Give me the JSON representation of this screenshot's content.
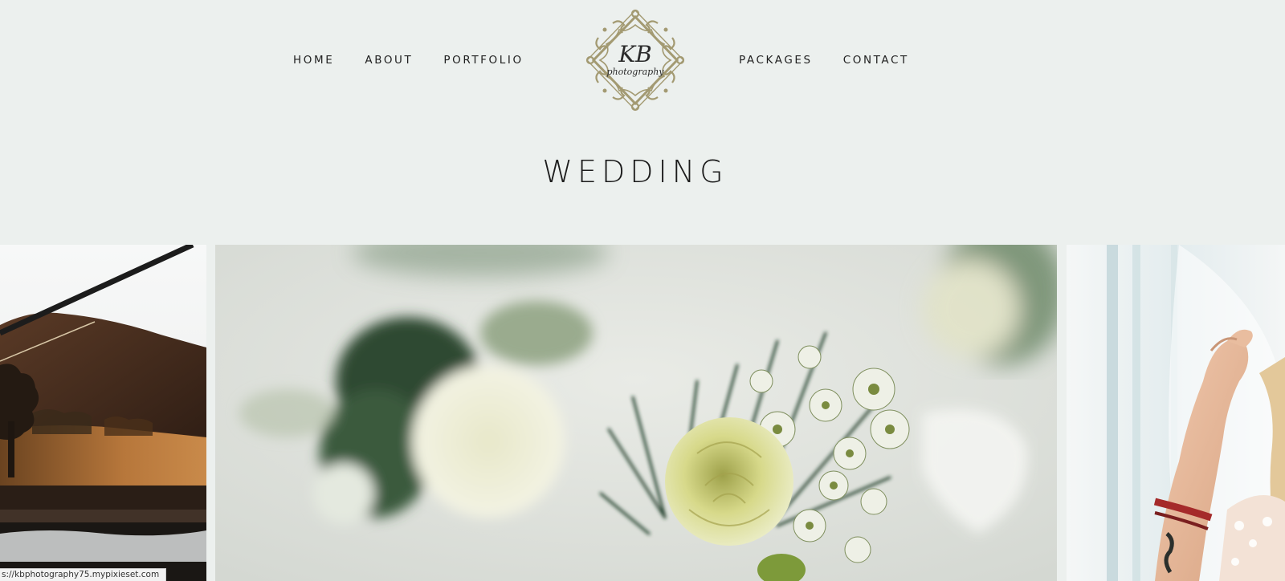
{
  "nav": {
    "left": [
      {
        "label": "HOME"
      },
      {
        "label": "ABOUT"
      },
      {
        "label": "PORTFOLIO"
      }
    ],
    "right": [
      {
        "label": "PACKAGES"
      },
      {
        "label": "CONTACT"
      }
    ]
  },
  "logo": {
    "initials": "KB",
    "subtitle": "photography",
    "color": "#a39a72"
  },
  "page": {
    "title": "WEDDING"
  },
  "gallery": {
    "photos": [
      {
        "subject": "landscape-sunset-hill"
      },
      {
        "subject": "rose-boutonnieres"
      },
      {
        "subject": "bride-veil"
      }
    ]
  },
  "status_bar": {
    "url": "s://kbphotography75.mypixieset.com"
  },
  "colors": {
    "background": "#ecf0ee",
    "text": "#1f1f1f",
    "logo_gold": "#a39a72"
  }
}
